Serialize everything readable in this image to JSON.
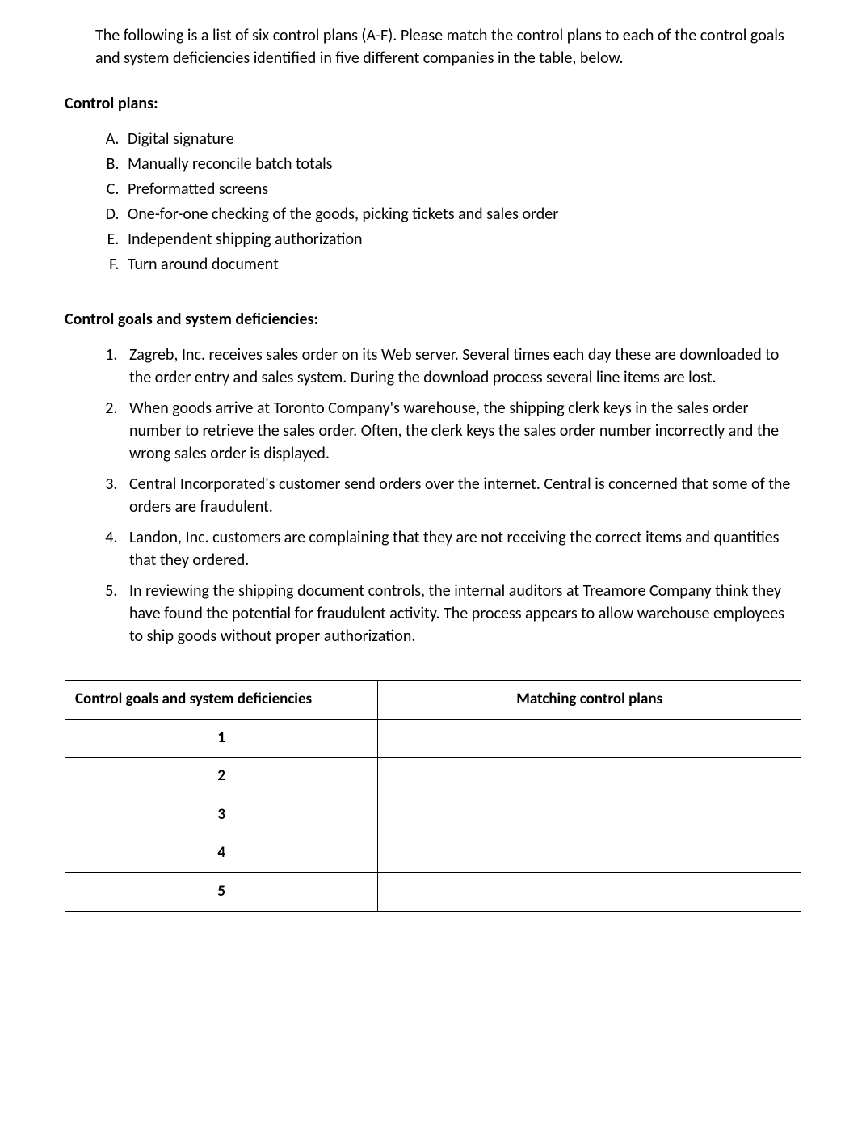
{
  "intro": "The following is a list of six control plans (A-F). Please match the control plans to each of the control goals and system deficiencies identified in five different companies in the table, below.",
  "controlPlansHeading": "Control plans:",
  "controlPlans": [
    "Digital signature",
    "Manually reconcile batch totals",
    "Preformatted screens",
    "One-for-one checking of the goods, picking tickets and sales order",
    "Independent shipping authorization",
    "Turn around document"
  ],
  "goalsHeading": "Control goals and system deficiencies:",
  "goals": [
    "Zagreb, Inc. receives sales order on its Web server. Several times each day these are downloaded to the order entry and sales system. During the download process several line items are lost.",
    "When goods arrive at Toronto Company's warehouse, the shipping clerk keys in the sales order number to retrieve the sales order. Often, the clerk keys the sales order number incorrectly and the wrong sales order is displayed.",
    "Central Incorporated's customer send orders over the internet. Central is concerned that some of the orders are fraudulent.",
    "Landon, Inc. customers are complaining that they are not receiving the correct items and quantities that they ordered.",
    "In reviewing the shipping document controls, the internal auditors at Treamore Company think they have found the potential for fraudulent activity. The process appears to allow warehouse employees to ship goods without proper authorization."
  ],
  "table": {
    "col1": "Control goals and system deficiencies",
    "col2": "Matching control plans",
    "rows": [
      {
        "num": "1",
        "answer": ""
      },
      {
        "num": "2",
        "answer": ""
      },
      {
        "num": "3",
        "answer": ""
      },
      {
        "num": "4",
        "answer": ""
      },
      {
        "num": "5",
        "answer": ""
      }
    ]
  }
}
